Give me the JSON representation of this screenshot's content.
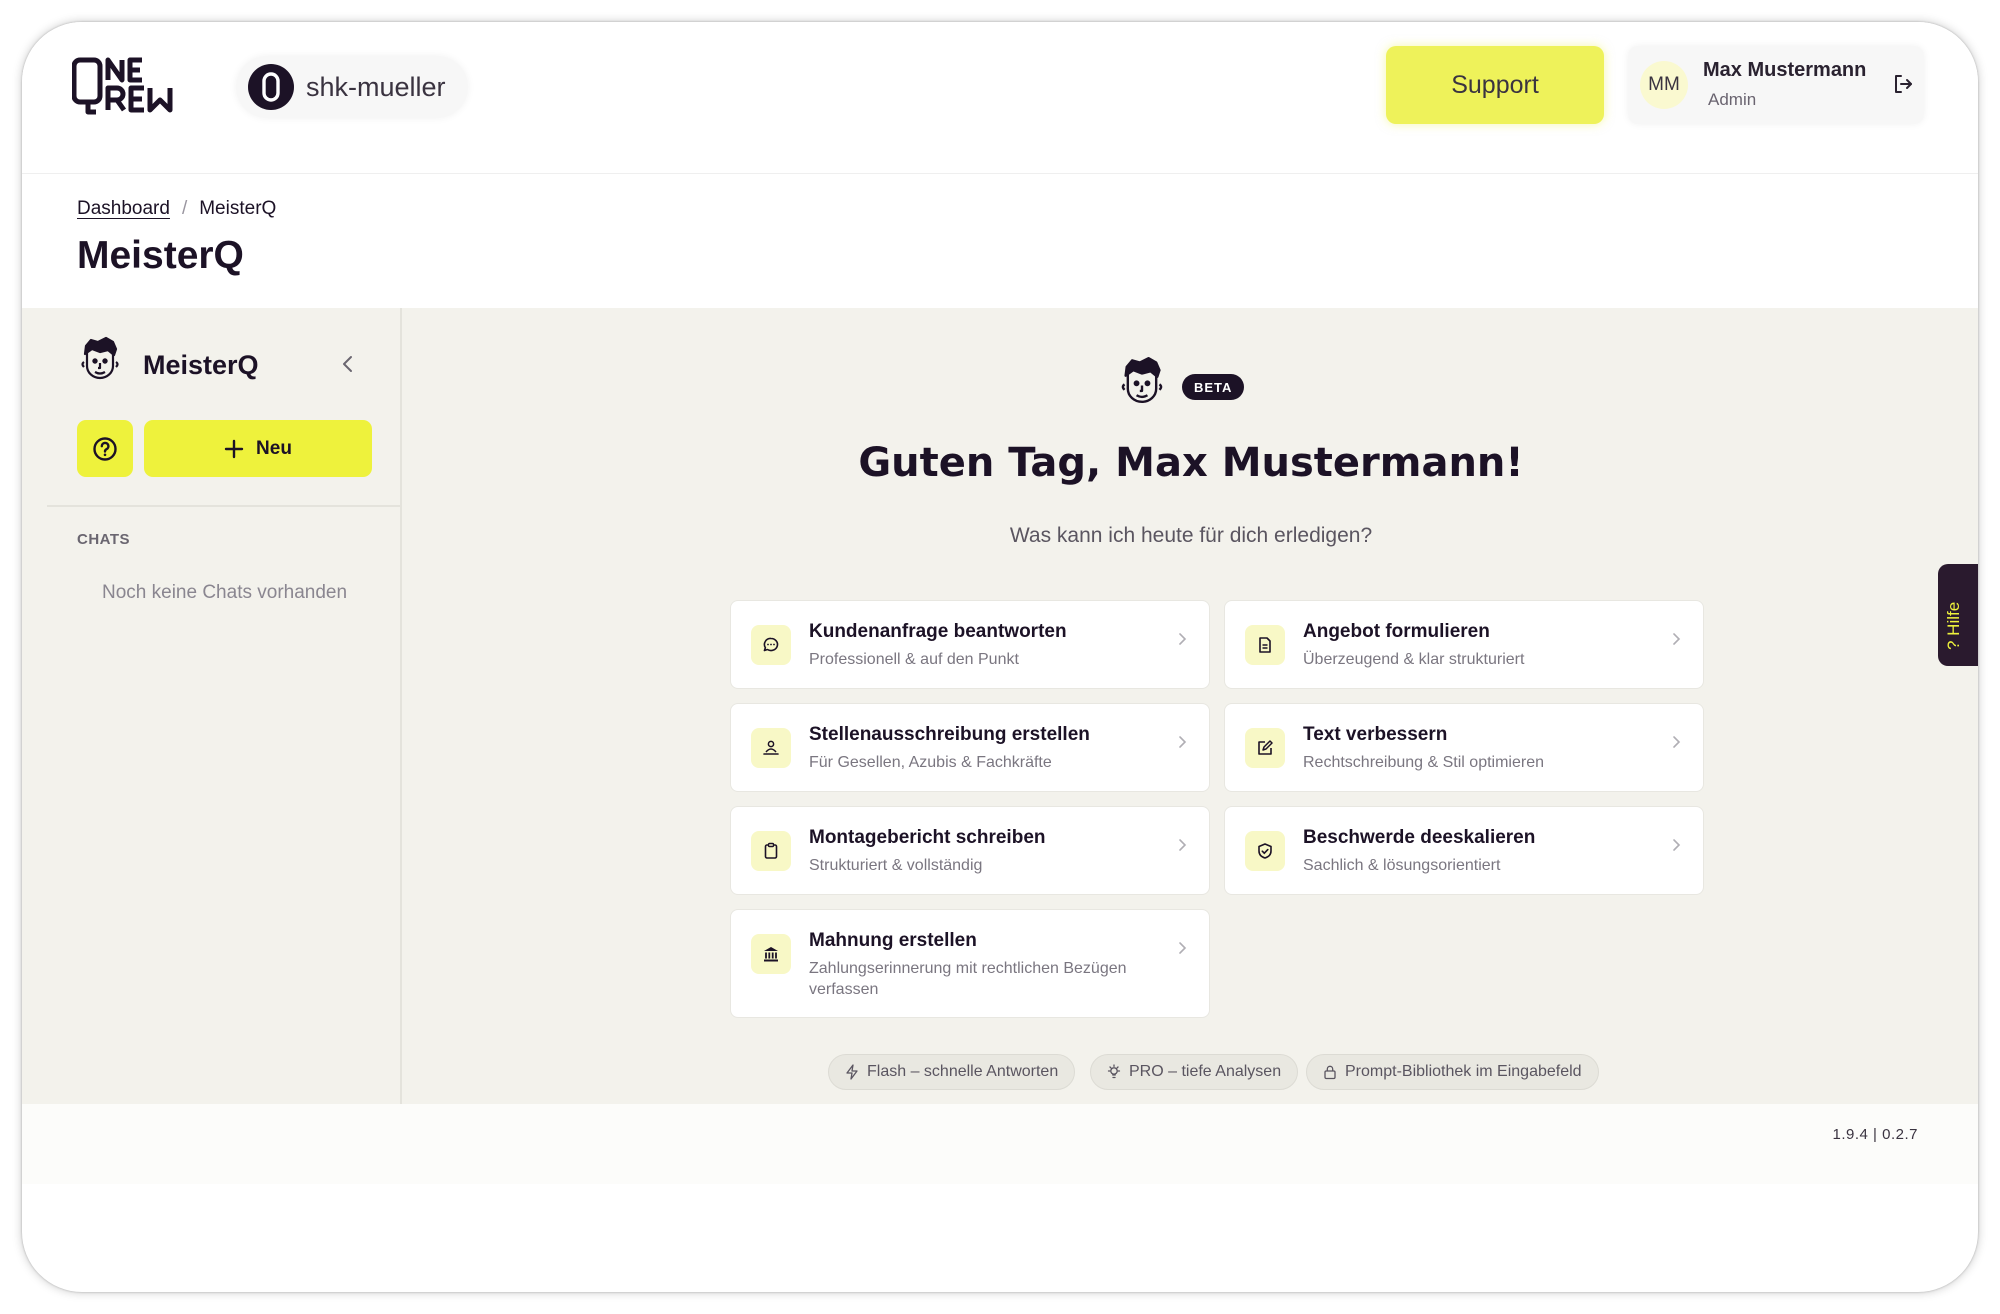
{
  "header": {
    "logo_text": "ONE QREW",
    "org_name": "shk-mueller",
    "support_label": "Support",
    "user": {
      "initials": "MM",
      "name": "Max Mustermann",
      "role": "Admin"
    }
  },
  "breadcrumb": {
    "parent": "Dashboard",
    "current": "MeisterQ"
  },
  "page_title": "MeisterQ",
  "sidebar": {
    "title": "MeisterQ",
    "new_label": "Neu",
    "chats_heading": "CHATS",
    "chats_empty": "Noch keine Chats vorhanden"
  },
  "main": {
    "badge": "BETA",
    "greeting": "Guten Tag, Max Mustermann!",
    "subtitle": "Was kann ich heute für dich erledigen?",
    "cards": [
      {
        "title": "Kundenanfrage beantworten",
        "desc": "Professionell & auf den Punkt",
        "icon": "message-bubble-icon"
      },
      {
        "title": "Angebot formulieren",
        "desc": "Überzeugend & klar strukturiert",
        "icon": "document-icon"
      },
      {
        "title": "Stellenausschreibung erstellen",
        "desc": "Für Gesellen, Azubis & Fachkräfte",
        "icon": "person-laptop-icon"
      },
      {
        "title": "Text verbessern",
        "desc": "Rechtschreibung & Stil optimieren",
        "icon": "edit-icon"
      },
      {
        "title": "Montagebericht schreiben",
        "desc": "Strukturiert & vollständig",
        "icon": "clipboard-icon"
      },
      {
        "title": "Beschwerde deeskalieren",
        "desc": "Sachlich & lösungsorientiert",
        "icon": "shield-check-icon"
      },
      {
        "title": "Mahnung erstellen",
        "desc": "Zahlungserinnerung mit rechtlichen Bezügen verfassen",
        "icon": "bank-icon"
      }
    ],
    "chips": [
      {
        "label": "Flash – schnelle Antworten",
        "icon": "lightning-icon"
      },
      {
        "label": "PRO – tiefe Analysen",
        "icon": "lightbulb-icon"
      },
      {
        "label": "Prompt-Bibliothek im Eingabefeld",
        "icon": "lock-icon"
      }
    ]
  },
  "help_tab": {
    "label": "? Hilfe"
  },
  "footer": {
    "version": "1.9.4 | 0.2.7"
  },
  "colors": {
    "accent": "#eef23c",
    "dark": "#1c1226",
    "workspace_bg": "#f3f2ec"
  }
}
